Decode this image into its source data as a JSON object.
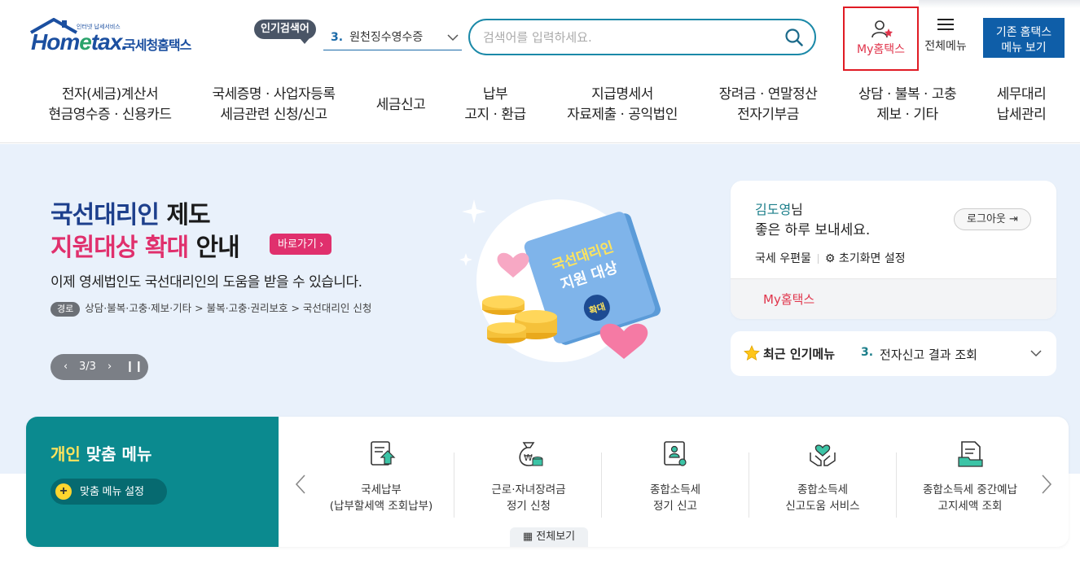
{
  "logo": {
    "brand": "Hometax.",
    "org": "국세청홈택스",
    "tagline": "인터넷 납세서비스"
  },
  "popular": {
    "badge": "인기검색어",
    "rank": "3.",
    "term": "원천징수영수증"
  },
  "search": {
    "placeholder": "검색어를 입력하세요."
  },
  "header": {
    "my_hometax": "My홈택스",
    "all_menu": "전체메뉴",
    "old_menu_line1": "기존 홈택스",
    "old_menu_line2": "메뉴 보기"
  },
  "nav": [
    {
      "line1": "전자(세금)계산서",
      "line2": "현금영수증 · 신용카드"
    },
    {
      "line1": "국세증명 · 사업자등록",
      "line2": "세금관련 신청/신고"
    },
    {
      "line1": "세금신고",
      "line2": ""
    },
    {
      "line1": "납부",
      "line2": "고지 · 환급"
    },
    {
      "line1": "지급명세서",
      "line2": "자료제출 · 공익법인"
    },
    {
      "line1": "장려금 · 연말정산",
      "line2": "전자기부금"
    },
    {
      "line1": "상담 · 불복 · 고충",
      "line2": "제보 · 기타"
    },
    {
      "line1": "세무대리",
      "line2": "납세관리"
    }
  ],
  "hero": {
    "title1_hl": "국선대리인",
    "title1_rest": " 제도",
    "title2_hl": "지원대상 확대",
    "title2_rest": " 안내",
    "goto": "바로가기 ›",
    "desc": "이제 영세법인도 국선대리인의 도움을 받을 수 있습니다.",
    "route_tag": "경로",
    "route": "상담·불복·고충·제보·기타 > 불복·고충·권리보호 > 국선대리인 신청",
    "page": "3/3",
    "book_line1": "국선대리인",
    "book_line2": "지원 대상",
    "book_badge": "확대"
  },
  "login": {
    "name": "김도영",
    "suffix": "님",
    "greet": "좋은 하루 보내세요.",
    "logout": "로그아웃",
    "mailbox": "국세 우편물",
    "reset": "초기화면 설정",
    "my_hometax": "My홈택스"
  },
  "recent": {
    "title": "최근 인기메뉴",
    "rank": "3.",
    "item": "전자신고 결과 조회"
  },
  "personal": {
    "title_hl": "개인",
    "title_rest": " 맞춤 메뉴",
    "custom_btn": "맞춤 메뉴 설정",
    "view_all": "전체보기",
    "items": [
      {
        "line1": "국세납부",
        "line2": "(납부할세액 조회납부)"
      },
      {
        "line1": "근로·자녀장려금",
        "line2": "정기 신청"
      },
      {
        "line1": "종합소득세",
        "line2": "정기 신고"
      },
      {
        "line1": "종합소득세",
        "line2": "신고도움 서비스"
      },
      {
        "line1": "종합소득세 중간예납",
        "line2": "고지세액 조회"
      }
    ]
  },
  "colors": {
    "brand": "#1b4fa0",
    "accent_teal": "#0b8a8f",
    "pink": "#e0306d",
    "highlight_red": "#e01b24"
  }
}
